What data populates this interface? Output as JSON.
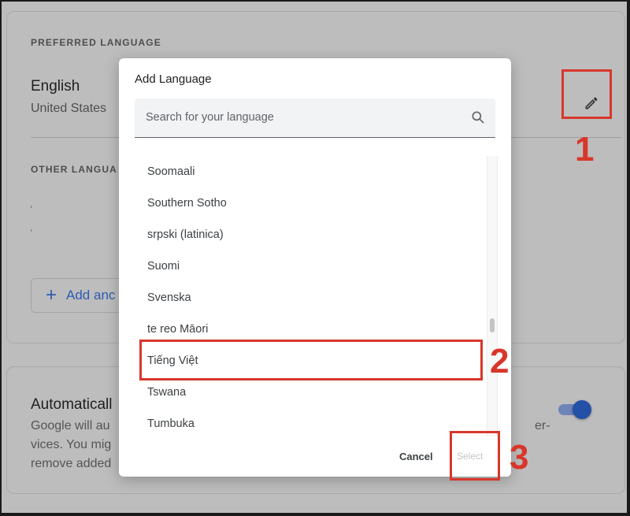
{
  "preferred": {
    "section_label": "PREFERRED LANGUAGE",
    "language": "English",
    "region": "United States"
  },
  "other": {
    "section_label": "OTHER LANGUA",
    "add_button_label": "Add anc"
  },
  "auto": {
    "title": "Automaticall",
    "desc_lines": [
      "Google will au",
      "vices. You mig",
      "remove added"
    ],
    "desc_right_lines": [
      "er-",
      ""
    ],
    "toggle_on": true
  },
  "dialog": {
    "title": "Add Language",
    "search_placeholder": "Search for your language",
    "search_value": "",
    "items": [
      "Soomaali",
      "Southern Sotho",
      "srpski (latinica)",
      "Suomi",
      "Svenska",
      "te reo Māori",
      "Tiếng Việt",
      "Tswana",
      "Tumbuka"
    ],
    "highlighted_item": "Tiếng Việt",
    "cancel_label": "Cancel",
    "select_label": "Select"
  },
  "annotations": {
    "step1": "1",
    "step2": "2",
    "step3": "3",
    "color": "#d9362b"
  },
  "colors": {
    "accent_blue": "#2f5bb5",
    "toggle_knob": "#2450a8"
  }
}
